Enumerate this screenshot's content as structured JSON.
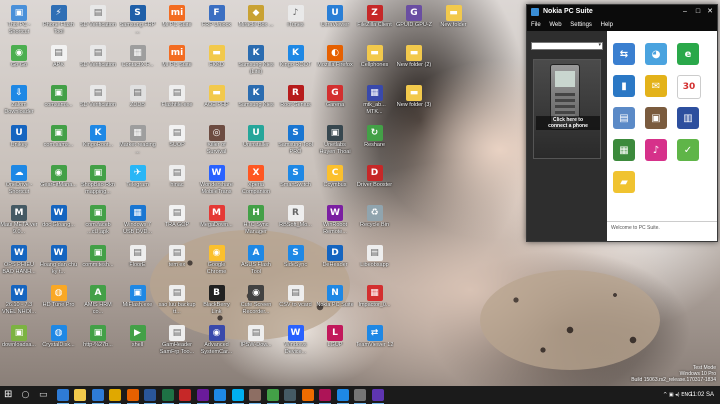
{
  "desktop": {
    "icons": [
      {
        "label": "This PC - Shortcut",
        "color": "#4a90d9",
        "glyph": "▣"
      },
      {
        "label": "Phone Flash Tool",
        "color": "#2f6fb5",
        "glyph": "⚡"
      },
      {
        "label": "SD Verification",
        "color": "#e8e8e8",
        "glyph": "▤"
      },
      {
        "label": "Samsung FRP ...",
        "color": "#1f5fa8",
        "glyph": "S"
      },
      {
        "label": "Mi PC Suite",
        "color": "#f36c21",
        "glyph": "mi"
      },
      {
        "label": "FRP Unlock",
        "color": "#3b6fc2",
        "glyph": "F"
      },
      {
        "label": "Miracle Box ...",
        "color": "#c9a233",
        "glyph": "◆"
      },
      {
        "label": "iTunes",
        "color": "#e9e9e9",
        "glyph": "♪"
      },
      {
        "label": "UltraViewer",
        "color": "#2a7fd6",
        "glyph": "U"
      },
      {
        "label": "FileZilla Client",
        "color": "#c62828",
        "glyph": "Z"
      },
      {
        "label": "GPUID GPU-Z",
        "color": "#6a4ea2",
        "glyph": "G"
      },
      {
        "label": "New folder",
        "color": "#f2c94c",
        "glyph": "▬"
      },
      {
        "label": "Gõ Gõ",
        "color": "#4caf50",
        "glyph": "◉"
      },
      {
        "label": "APK",
        "color": "#f2f2f2",
        "glyph": "▤"
      },
      {
        "label": "SD Verification",
        "color": "#e8e8e8",
        "glyph": "▤"
      },
      {
        "label": "ContactX-F...",
        "color": "#9e9e9e",
        "glyph": "▦"
      },
      {
        "label": "MI PC Suite",
        "color": "#f36c21",
        "glyph": "mi"
      },
      {
        "label": "FKKD",
        "color": "#f2c94c",
        "glyph": "▬"
      },
      {
        "label": "Samsung Kies (Lite)",
        "color": "#2b6cb0",
        "glyph": "K"
      },
      {
        "label": "Kingo ROOT",
        "color": "#1e88e5",
        "glyph": "K"
      },
      {
        "label": "Mozilla Firefox",
        "color": "#e66000",
        "glyph": "◐"
      },
      {
        "label": "Cellphones",
        "color": "#f2c94c",
        "glyph": "▬"
      },
      {
        "label": "New folder (2)",
        "color": "#f2c94c",
        "glyph": "▬"
      },
      {
        "label": "Zalom Downloader",
        "color": "#1e88e5",
        "glyph": "⇩"
      },
      {
        "label": "comsams...",
        "color": "#43a047",
        "glyph": "▣"
      },
      {
        "label": "SD Verification",
        "color": "#e8e8e8",
        "glyph": "▤"
      },
      {
        "label": "ZDDB",
        "color": "#e0e0e0",
        "glyph": "▤"
      },
      {
        "label": "Flashfile.exe",
        "color": "#eeeeee",
        "glyph": "▤"
      },
      {
        "label": "AOE PHP",
        "color": "#f2c94c",
        "glyph": "▬"
      },
      {
        "label": "Samsung Kies",
        "color": "#2b6cb0",
        "glyph": "K"
      },
      {
        "label": "Root Genius",
        "color": "#b71c1c",
        "glyph": "R"
      },
      {
        "label": "Garena",
        "color": "#d32f2f",
        "glyph": "G"
      },
      {
        "label": "mtk_ab... MTK...",
        "color": "#3949ab",
        "glyph": "▦"
      },
      {
        "label": "New folder (3)",
        "color": "#f2c94c",
        "glyph": "▬"
      },
      {
        "label": "Unikey",
        "color": "#1565c0",
        "glyph": "U"
      },
      {
        "label": "com.sams...",
        "color": "#43a047",
        "glyph": "▣"
      },
      {
        "label": "KingoRoot...",
        "color": "#1e88e5",
        "glyph": "K"
      },
      {
        "label": "Market reading ...",
        "color": "#9e9e9e",
        "glyph": "▦"
      },
      {
        "label": "SUOP",
        "color": "#f2f2f2",
        "glyph": "▤"
      },
      {
        "label": "Killer of Survival",
        "color": "#6d4c41",
        "glyph": "◎"
      },
      {
        "label": "Uninstaller",
        "color": "#26a69a",
        "glyph": "U"
      },
      {
        "label": "Samsung Tool PRO",
        "color": "#1976d2",
        "glyph": "S"
      },
      {
        "label": "Unetlabs Huyen Thoai",
        "color": "#37474f",
        "glyph": "▣"
      },
      {
        "label": "Reshare",
        "color": "#43a047",
        "glyph": "↻"
      },
      {
        "label": "OneDrive - Shortcut",
        "color": "#1e88e5",
        "glyph": "☁"
      },
      {
        "label": "GearFitMana...",
        "color": "#43a047",
        "glyph": "◉"
      },
      {
        "label": "ShopBao Rkn mapping...",
        "color": "#43a047",
        "glyph": "▣"
      },
      {
        "label": "Telegram",
        "color": "#29b6f6",
        "glyph": "✈"
      },
      {
        "label": "hinac",
        "color": "#eeeeee",
        "glyph": "▤"
      },
      {
        "label": "Wondershare MobileTrans",
        "color": "#2962ff",
        "glyph": "W"
      },
      {
        "label": "Xperia Companion",
        "color": "#ff5722",
        "glyph": "X"
      },
      {
        "label": "SmartSwitch",
        "color": "#1e88e5",
        "glyph": "S"
      },
      {
        "label": "Ccymbus",
        "color": "#fbc02d",
        "glyph": "C"
      },
      {
        "label": "Driver Booster",
        "color": "#c62828",
        "glyph": "D"
      },
      {
        "label": "Maui META ver 9.0...",
        "color": "#455a64",
        "glyph": "M"
      },
      {
        "label": "doc Gloang...",
        "color": "#1565c0",
        "glyph": "W"
      },
      {
        "label": "com.faceb ...cU.apk",
        "color": "#43a047",
        "glyph": "▣"
      },
      {
        "label": "Windows 7 USB DVD...",
        "color": "#1976d2",
        "glyph": "▦"
      },
      {
        "label": "TRA GOP",
        "color": "#f2f2f2",
        "glyph": "▤"
      },
      {
        "label": "MegaDown...",
        "color": "#e53935",
        "glyph": "M"
      },
      {
        "label": "HTC Sync Manager",
        "color": "#43a047",
        "glyph": "H"
      },
      {
        "label": "RBSoft_Mo...",
        "color": "#eeeeee",
        "glyph": "R"
      },
      {
        "label": "WinRobot Remote...",
        "color": "#7b1fa2",
        "glyph": "W"
      },
      {
        "label": "Recycle Bin",
        "color": "#90a4ae",
        "glyph": "♻"
      },
      {
        "label": "OPS PHIEU BAO HANH...",
        "color": "#1565c0",
        "glyph": "W"
      },
      {
        "label": "Hoang dan chu ky t...",
        "color": "#1565c0",
        "glyph": "W"
      },
      {
        "label": "commitesh...",
        "color": "#43a047",
        "glyph": "▣"
      },
      {
        "label": "FloorE",
        "color": "#eeeeee",
        "glyph": "▤"
      },
      {
        "label": "tem ex",
        "color": "#eeeeee",
        "glyph": "▤"
      },
      {
        "label": "Google Chrome",
        "color": "#fbc02d",
        "glyph": "◉"
      },
      {
        "label": "ASUS Flash Tool",
        "color": "#1e88e5",
        "glyph": "A"
      },
      {
        "label": "SideSync",
        "color": "#1e88e5",
        "glyph": "S"
      },
      {
        "label": "DeHeader",
        "color": "#1565c0",
        "glyph": "D"
      },
      {
        "label": "Libeobsapp",
        "color": "#eeeeee",
        "glyph": "▤"
      },
      {
        "label": "26.10 - 7.3 VNEL NHOI...",
        "color": "#1565c0",
        "glyph": "W"
      },
      {
        "label": "HD Tune Pro",
        "color": "#f9a825",
        "glyph": "◍"
      },
      {
        "label": "AMIS HRM co...",
        "color": "#43a047",
        "glyph": "A"
      },
      {
        "label": "MiFlash.exe",
        "color": "#1e88e5",
        "glyph": "▣"
      },
      {
        "label": "sao luu backup tt...",
        "color": "#eeeeee",
        "glyph": "▤"
      },
      {
        "label": "BlackBerry Link",
        "color": "#212121",
        "glyph": "B"
      },
      {
        "label": "Cute Screen Recorder...",
        "color": "#424242",
        "glyph": "◉"
      },
      {
        "label": "CSV to vcard",
        "color": "#eeeeee",
        "glyph": "▤"
      },
      {
        "label": "Nokia PC Suite",
        "color": "#1e88e5",
        "glyph": "N"
      },
      {
        "label": "Impactor_0...",
        "color": "#d32f2f",
        "glyph": "▦"
      },
      {
        "label": "downloadsa...",
        "color": "#7cb342",
        "glyph": "▣"
      },
      {
        "label": "CrystalDisk...",
        "color": "#1e88e5",
        "glyph": "◍"
      },
      {
        "label": "http-%27b...",
        "color": "#43a047",
        "glyph": "▣"
      },
      {
        "label": "shell",
        "color": "#43a047",
        "glyph": "▶"
      },
      {
        "label": "GamHeader SamFrp Too...",
        "color": "#eeeeee",
        "glyph": "▤"
      },
      {
        "label": "Advanced SystemCar...",
        "color": "#3949ab",
        "glyph": "◉"
      },
      {
        "label": "IPSW-Dow...",
        "color": "#eeeeee",
        "glyph": "▤"
      },
      {
        "label": "Windows Device...",
        "color": "#2962ff",
        "glyph": "W"
      },
      {
        "label": "LGUP",
        "color": "#c2185b",
        "glyph": "L"
      },
      {
        "label": "TeamViewer 12",
        "color": "#1e88e5",
        "glyph": "⇄"
      }
    ]
  },
  "pcsuite": {
    "title": "Nokia PC Suite",
    "window_controls": {
      "minimize": "–",
      "maximize": "□",
      "close": "✕"
    },
    "menu": [
      "File",
      "Web",
      "Settings",
      "Help"
    ],
    "device_combo_value": "",
    "connect_line1": "Click here to",
    "connect_line2": "connect a phone",
    "status": "Welcome to PC Suite.",
    "apps": [
      {
        "name": "sync",
        "color": "#3a7fd0",
        "glyph": "⇆"
      },
      {
        "name": "connect to internet",
        "color": "#4aa3df",
        "glyph": "◕"
      },
      {
        "name": "browse",
        "color": "#2aa84a",
        "glyph": "e"
      },
      {
        "name": "file manager",
        "color": "#2b78c5",
        "glyph": "▮"
      },
      {
        "name": "messages",
        "color": "#e3b21a",
        "glyph": "✉"
      },
      {
        "name": "calendar",
        "color": "#ffffff",
        "glyph": "30"
      },
      {
        "name": "backup",
        "color": "#5b8ac7",
        "glyph": "▤"
      },
      {
        "name": "images",
        "color": "#7a5b3e",
        "glyph": "▣"
      },
      {
        "name": "video",
        "color": "#2d4f9e",
        "glyph": "▥"
      },
      {
        "name": "install applications",
        "color": "#3c8a3c",
        "glyph": "▦"
      },
      {
        "name": "music",
        "color": "#d6318a",
        "glyph": "♪"
      },
      {
        "name": "update",
        "color": "#5fb548",
        "glyph": "✓"
      },
      {
        "name": "settings",
        "color": "#f0c330",
        "glyph": "▰"
      }
    ]
  },
  "watermark": {
    "line1": "Test Mode",
    "line2": "Windows 10 Pro",
    "line3": "Build 15063.rs2_release.170317-1834"
  },
  "taskbar": {
    "items": [
      {
        "name": "start",
        "color": "#ffffff"
      },
      {
        "name": "search",
        "color": "#dcdcdc"
      },
      {
        "name": "task view",
        "color": "#dcdcdc"
      },
      {
        "name": "edge",
        "color": "#2e7bd6"
      },
      {
        "name": "file explorer",
        "color": "#f2c94c"
      },
      {
        "name": "store",
        "color": "#2e7bd6"
      },
      {
        "name": "chrome",
        "color": "#e0a800"
      },
      {
        "name": "firefox",
        "color": "#e66000"
      },
      {
        "name": "word",
        "color": "#2a5699"
      },
      {
        "name": "excel",
        "color": "#1e7145"
      },
      {
        "name": "app1",
        "color": "#c62828"
      },
      {
        "name": "app2",
        "color": "#6a1b9a"
      },
      {
        "name": "zalo",
        "color": "#1e88e5"
      },
      {
        "name": "skype",
        "color": "#00aff0"
      },
      {
        "name": "app3",
        "color": "#8d6e63"
      },
      {
        "name": "app4",
        "color": "#43a047"
      },
      {
        "name": "app5",
        "color": "#455a64"
      },
      {
        "name": "app6",
        "color": "#ef6c00"
      },
      {
        "name": "app7",
        "color": "#ad1457"
      },
      {
        "name": "nokia pc suite",
        "color": "#1e88e5"
      },
      {
        "name": "app8",
        "color": "#757575"
      },
      {
        "name": "app9",
        "color": "#5e35b1"
      }
    ],
    "tray": "^  ▣  ◂)  ENG",
    "time": "11:02 SA"
  }
}
